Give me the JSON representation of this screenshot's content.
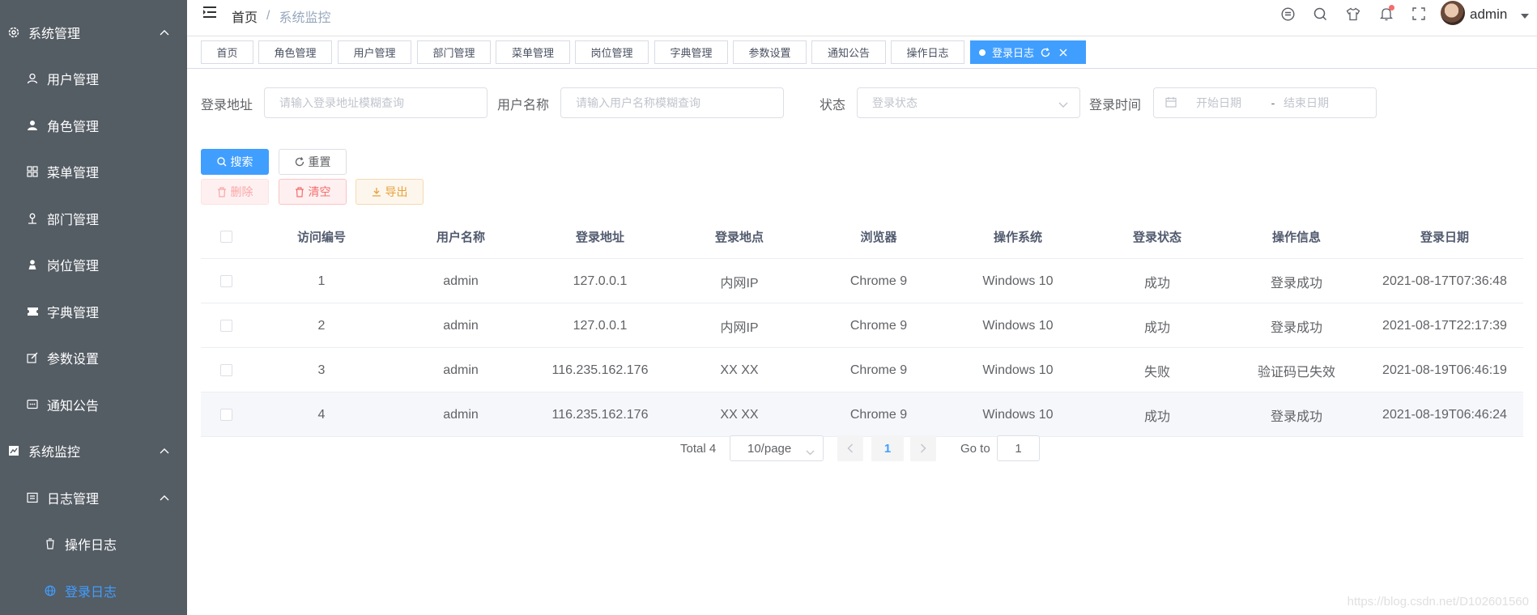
{
  "sidebar": {
    "items": [
      {
        "label": "系统管理",
        "icon": "gear-icon"
      },
      {
        "label": "用户管理",
        "icon": "user-icon"
      },
      {
        "label": "角色管理",
        "icon": "user-filled-icon"
      },
      {
        "label": "菜单管理",
        "icon": "grid-icon"
      },
      {
        "label": "部门管理",
        "icon": "department-icon"
      },
      {
        "label": "岗位管理",
        "icon": "post-icon"
      },
      {
        "label": "字典管理",
        "icon": "ticket-icon"
      },
      {
        "label": "参数设置",
        "icon": "edit-icon"
      },
      {
        "label": "通知公告",
        "icon": "message-icon"
      },
      {
        "label": "系统监控",
        "icon": "monitor-icon"
      },
      {
        "label": "日志管理",
        "icon": "log-icon"
      },
      {
        "label": "操作日志",
        "icon": "cup-icon"
      },
      {
        "label": "登录日志",
        "icon": "globe-icon"
      }
    ]
  },
  "header": {
    "breadcrumb": {
      "home": "首页",
      "separator": "/",
      "current": "系统监控"
    },
    "username": "admin"
  },
  "tags": [
    "首页",
    "角色管理",
    "用户管理",
    "部门管理",
    "菜单管理",
    "岗位管理",
    "字典管理",
    "参数设置",
    "通知公告",
    "操作日志",
    "登录日志"
  ],
  "filters": {
    "ipaddr": {
      "label": "登录地址",
      "placeholder": "请输入登录地址模糊查询"
    },
    "username": {
      "label": "用户名称",
      "placeholder": "请输入用户名称模糊查询"
    },
    "status": {
      "label": "状态",
      "placeholder": "登录状态"
    },
    "login_time": {
      "label": "登录时间",
      "start_placeholder": "开始日期",
      "range_sep": "-",
      "end_placeholder": "结束日期"
    }
  },
  "buttons": {
    "search": "搜索",
    "reset": "重置",
    "delete": "删除",
    "clean": "清空",
    "export": "导出"
  },
  "table": {
    "columns": [
      "访问编号",
      "用户名称",
      "登录地址",
      "登录地点",
      "浏览器",
      "操作系统",
      "登录状态",
      "操作信息",
      "登录日期"
    ],
    "rows": [
      [
        "1",
        "admin",
        "127.0.0.1",
        "内网IP",
        "Chrome 9",
        "Windows 10",
        "成功",
        "登录成功",
        "2021-08-17T07:36:48"
      ],
      [
        "2",
        "admin",
        "127.0.0.1",
        "内网IP",
        "Chrome 9",
        "Windows 10",
        "成功",
        "登录成功",
        "2021-08-17T22:17:39"
      ],
      [
        "3",
        "admin",
        "116.235.162.176",
        "XX XX",
        "Chrome 9",
        "Windows 10",
        "失败",
        "验证码已失效",
        "2021-08-19T06:46:19"
      ],
      [
        "4",
        "admin",
        "116.235.162.176",
        "XX XX",
        "Chrome 9",
        "Windows 10",
        "成功",
        "登录成功",
        "2021-08-19T06:46:24"
      ]
    ]
  },
  "pagination": {
    "total": "Total 4",
    "page_size": "10/page",
    "current_page": "1",
    "goto_label": "Go to",
    "goto_value": "1"
  },
  "watermark": "https://blog.csdn.net/D102601560",
  "colors": {
    "sidebar_bg": "#545c64",
    "primary": "#409eff",
    "danger": "#f56c6c",
    "warning": "#e6a23c"
  }
}
